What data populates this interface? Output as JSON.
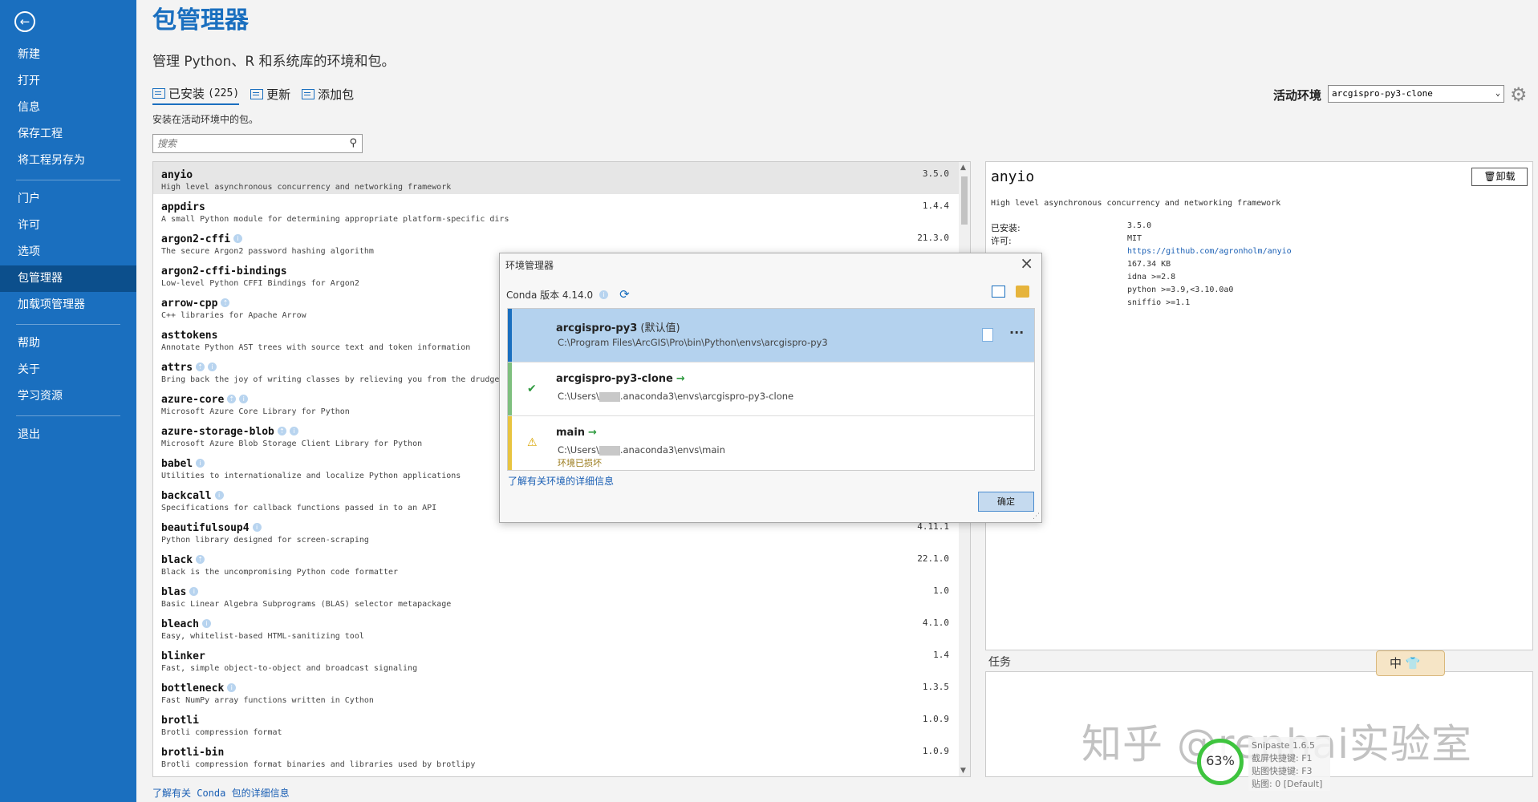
{
  "sidebar": {
    "back_icon": "arrow-left-icon",
    "items": [
      {
        "label": "新建"
      },
      {
        "label": "打开"
      },
      {
        "label": "信息"
      },
      {
        "label": "保存工程"
      },
      {
        "label": "将工程另存为"
      },
      {
        "label": "门户"
      },
      {
        "label": "许可"
      },
      {
        "label": "选项"
      },
      {
        "label": "包管理器"
      },
      {
        "label": "加载项管理器"
      },
      {
        "label": "帮助"
      },
      {
        "label": "关于"
      },
      {
        "label": "学习资源"
      },
      {
        "label": "退出"
      }
    ]
  },
  "header": {
    "title": "包管理器",
    "subtitle": "管理 Python、R 和系统库的环境和包。"
  },
  "tabs": {
    "installed": "已安装",
    "installed_count": "(225)",
    "updates": "更新",
    "add": "添加包"
  },
  "list_description": "安装在活动环境中的包。",
  "search": {
    "placeholder": "搜索"
  },
  "active_env": {
    "label": "活动环境",
    "value": "arcgispro-py3-clone"
  },
  "packages": [
    {
      "name": "anyio",
      "desc": "High level asynchronous concurrency and networking framework",
      "version": "3.5.0"
    },
    {
      "name": "appdirs",
      "desc": "A small Python module for determining appropriate platform-specific dirs",
      "version": "1.4.4"
    },
    {
      "name": "argon2-cffi",
      "desc": "The secure Argon2 password hashing algorithm",
      "version": "21.3.0"
    },
    {
      "name": "argon2-cffi-bindings",
      "desc": "Low-level Python CFFI Bindings for Argon2",
      "version": ""
    },
    {
      "name": "arrow-cpp",
      "desc": "C++ libraries for Apache Arrow",
      "version": ""
    },
    {
      "name": "asttokens",
      "desc": "Annotate Python AST trees with source text and token information",
      "version": ""
    },
    {
      "name": "attrs",
      "desc": "Bring back the joy of writing classes by relieving you from the drudge",
      "version": ""
    },
    {
      "name": "azure-core",
      "desc": "Microsoft Azure Core Library for Python",
      "version": ""
    },
    {
      "name": "azure-storage-blob",
      "desc": "Microsoft Azure Blob Storage Client Library for Python",
      "version": ""
    },
    {
      "name": "babel",
      "desc": "Utilities to internationalize and localize Python applications",
      "version": ""
    },
    {
      "name": "backcall",
      "desc": "Specifications for callback functions passed in to an API",
      "version": ""
    },
    {
      "name": "beautifulsoup4",
      "desc": "Python library designed for screen-scraping",
      "version": "4.11.1"
    },
    {
      "name": "black",
      "desc": "Black is the uncompromising Python code formatter",
      "version": "22.1.0"
    },
    {
      "name": "blas",
      "desc": "Basic Linear Algebra Subprograms (BLAS) selector metapackage",
      "version": "1.0"
    },
    {
      "name": "bleach",
      "desc": "Easy, whitelist-based HTML-sanitizing tool",
      "version": "4.1.0"
    },
    {
      "name": "blinker",
      "desc": "Fast, simple object-to-object and broadcast signaling",
      "version": "1.4"
    },
    {
      "name": "bottleneck",
      "desc": "Fast NumPy array functions written in Cython",
      "version": "1.3.5"
    },
    {
      "name": "brotli",
      "desc": "Brotli compression format",
      "version": "1.0.9"
    },
    {
      "name": "brotli-bin",
      "desc": "Brotli compression format binaries and libraries used by brotlipy",
      "version": "1.0.9"
    }
  ],
  "learn_conda": "了解有关 Conda 包的详细信息",
  "detail": {
    "name": "anyio",
    "uninstall": "卸载",
    "desc": "High level asynchronous concurrency and networking framework",
    "rows": [
      {
        "key": "已安装:",
        "val": "3.5.0",
        "link": false
      },
      {
        "key": "许可:",
        "val": "MIT",
        "link": false
      },
      {
        "key": "",
        "val": "https://github.com/agronholm/anyio",
        "link": true
      },
      {
        "key": "",
        "val": "167.34 KB",
        "link": false
      },
      {
        "key": "",
        "val": "idna >=2.8",
        "link": false
      },
      {
        "key": "",
        "val": "python >=3.9,<3.10.0a0",
        "link": false
      },
      {
        "key": "",
        "val": "sniffio >=1.1",
        "link": false
      }
    ]
  },
  "tasks_label": "任务",
  "modal": {
    "title": "环境管理器",
    "conda_version": "Conda 版本 4.14.0",
    "envs": [
      {
        "name": "arcgispro-py3",
        "suffix": " (默认值)",
        "path_prefix": "C:\\Program Files\\ArcGIS\\Pro\\bin\\Python\\envs\\arcgispro-py3",
        "path_suffix": "",
        "status": "none",
        "warning": ""
      },
      {
        "name": "arcgispro-py3-clone",
        "suffix": "",
        "path_prefix": "C:\\Users\\",
        "path_suffix": ".anaconda3\\envs\\arcgispro-py3-clone",
        "status": "active",
        "warning": ""
      },
      {
        "name": "main",
        "suffix": "",
        "path_prefix": "C:\\Users\\",
        "path_suffix": ".anaconda3\\envs\\main",
        "status": "warning",
        "warning": "环境已损坏"
      }
    ],
    "learn_link": "了解有关环境的详细信息",
    "ok": "确定"
  },
  "ime": {
    "label": "中"
  },
  "overlay": {
    "watermark": "知乎 @renhai实验室",
    "perf": "63%",
    "hotkeys": [
      "Snipaste 1.6.5",
      "截屏快捷键: F1",
      "贴图快捷键: F3",
      "贴图: 0 [Default]"
    ]
  },
  "colors": {
    "accent": "#1a6fbf",
    "sidebar_active": "#0c4f8c",
    "ok_green": "#2e9a3e",
    "warning": "#e8c440"
  }
}
